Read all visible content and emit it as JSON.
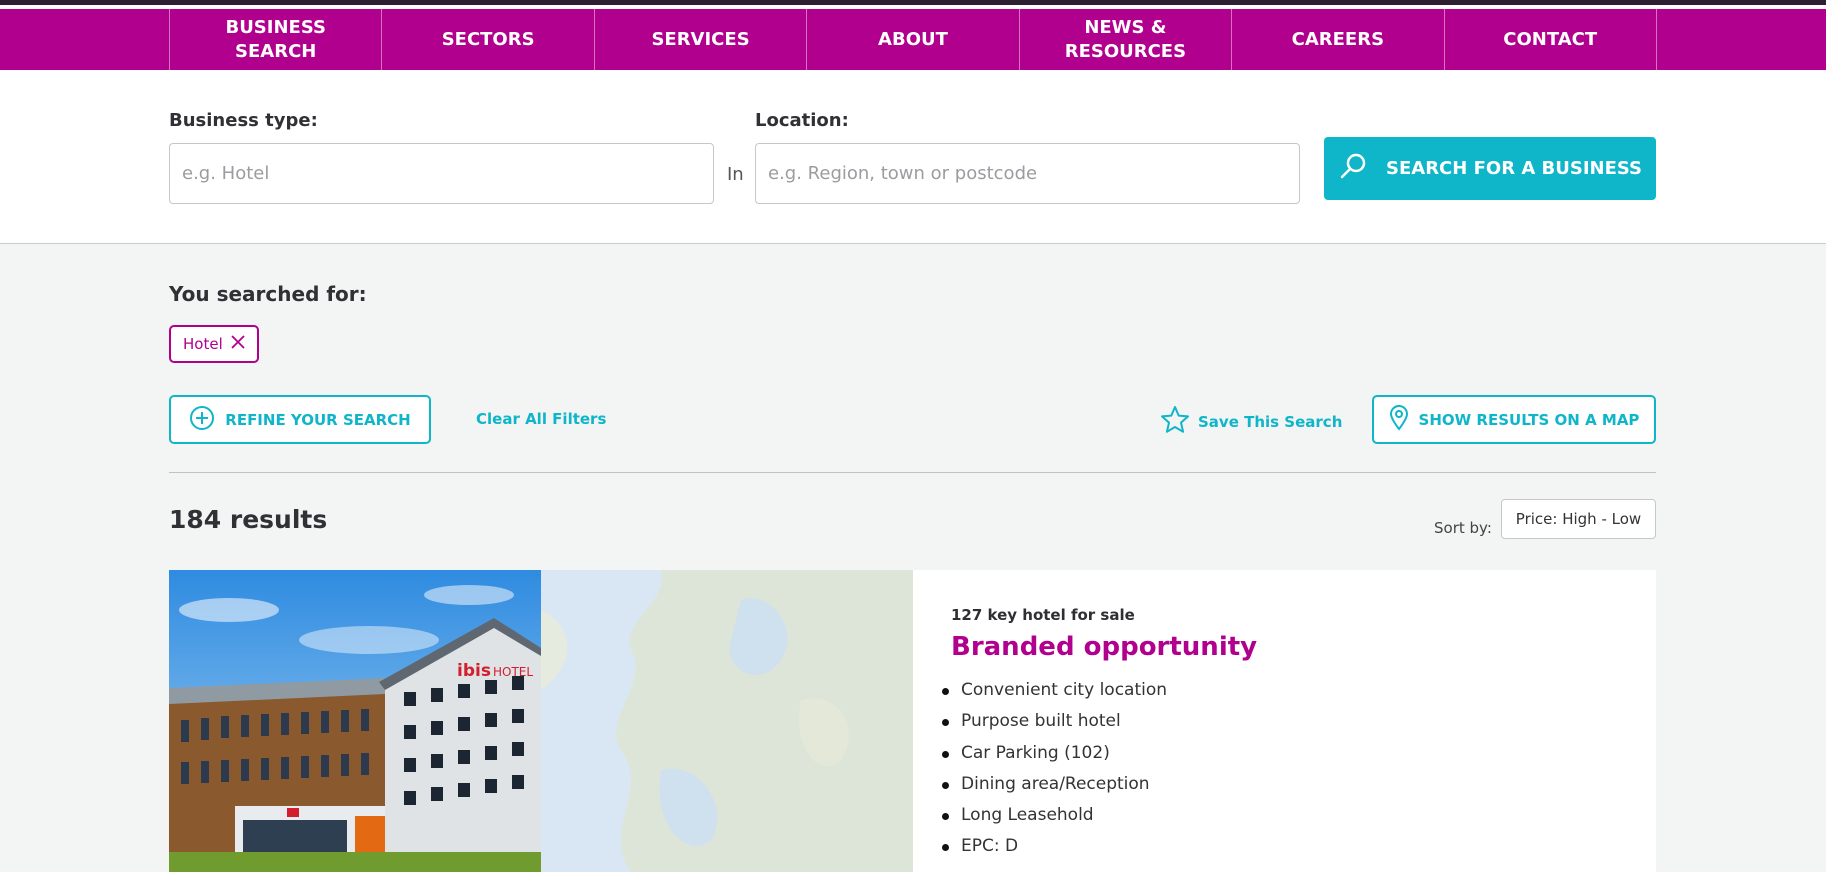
{
  "nav": {
    "items": [
      {
        "label": "BUSINESS\nSEARCH"
      },
      {
        "label": "SECTORS"
      },
      {
        "label": "SERVICES"
      },
      {
        "label": "ABOUT"
      },
      {
        "label": "NEWS &\nRESOURCES"
      },
      {
        "label": "CAREERS"
      },
      {
        "label": "CONTACT"
      }
    ]
  },
  "search": {
    "business_type_label": "Business type:",
    "business_type_placeholder": "e.g. Hotel",
    "in_label": "In",
    "location_label": "Location:",
    "location_placeholder": "e.g. Region, town or postcode",
    "button_label": "SEARCH FOR A BUSINESS"
  },
  "filters": {
    "searched_for_label": "You searched for:",
    "chip_label": "Hotel",
    "refine_label": "REFINE YOUR SEARCH",
    "clear_label": "Clear All Filters",
    "save_label": "Save This Search",
    "map_label": "SHOW RESULTS ON A MAP"
  },
  "results": {
    "count_label": "184 results",
    "sort_label": "Sort by:",
    "sort_value": "Price: High - Low"
  },
  "listing": {
    "subtitle": "127 key hotel for sale",
    "title": "Branded opportunity",
    "sign_text": "ibis",
    "sign_text_2": "HOTEL",
    "features": [
      "Convenient city location",
      "Purpose built hotel",
      "Car Parking (102)",
      "Dining area/Reception",
      "Long Leasehold",
      "EPC: D"
    ]
  },
  "colors": {
    "brand_magenta": "#b1008d",
    "accent_teal": "#0fb5c9"
  },
  "icons": {
    "search_button": "search-icon",
    "chip_remove": "close-icon",
    "refine": "plus-circle-icon",
    "save": "star-icon",
    "map": "map-pin-icon"
  }
}
